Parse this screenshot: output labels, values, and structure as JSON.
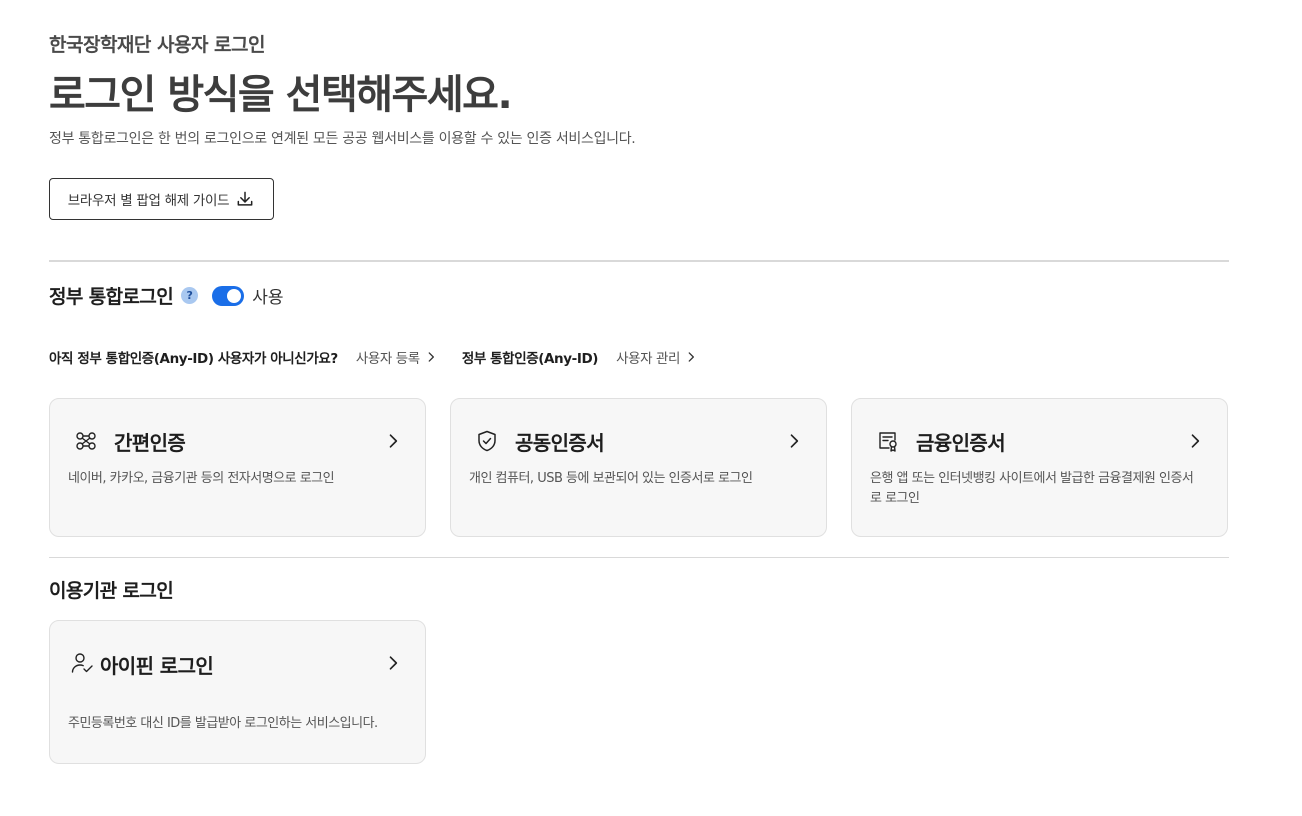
{
  "header": {
    "org_title": "한국장학재단 사용자 로그인",
    "page_title": "로그인 방식을 선택해주세요.",
    "description": "정부 통합로그인은 한 번의 로그인으로 연계된 모든 공공 웹서비스를 이용할 수 있는 인증 서비스입니다.",
    "guide_button": "브라우저 별 팝업 해제 가이드"
  },
  "gov_login": {
    "title": "정부 통합로그인",
    "help_icon_glyph": "?",
    "toggle_label": "사용",
    "toggle_on": true,
    "accent_color": "#1a6ee8",
    "prompt": "아직 정부 통합인증(Any-ID) 사용자가 아니신가요?",
    "register_link": "사용자 등록",
    "anyid_label": "정부 통합인증(Any-ID)",
    "manage_link": "사용자 관리",
    "cards": [
      {
        "icon": "simple-auth-icon",
        "title": "간편인증",
        "desc": "네이버, 카카오, 금융기관 등의 전자서명으로 로그인"
      },
      {
        "icon": "shield-check-icon",
        "title": "공동인증서",
        "desc": "개인 컴퓨터, USB 등에 보관되어 있는 인증서로 로그인"
      },
      {
        "icon": "certificate-icon",
        "title": "금융인증서",
        "desc": "은행 앱 또는 인터넷뱅킹 사이트에서 발급한 금융결제원 인증서로 로그인"
      }
    ]
  },
  "agency_login": {
    "title": "이용기관 로그인",
    "card": {
      "icon": "user-check-icon",
      "title": "아이핀 로그인",
      "desc": "주민등록번호 대신 ID를 발급받아 로그인하는 서비스입니다."
    }
  }
}
